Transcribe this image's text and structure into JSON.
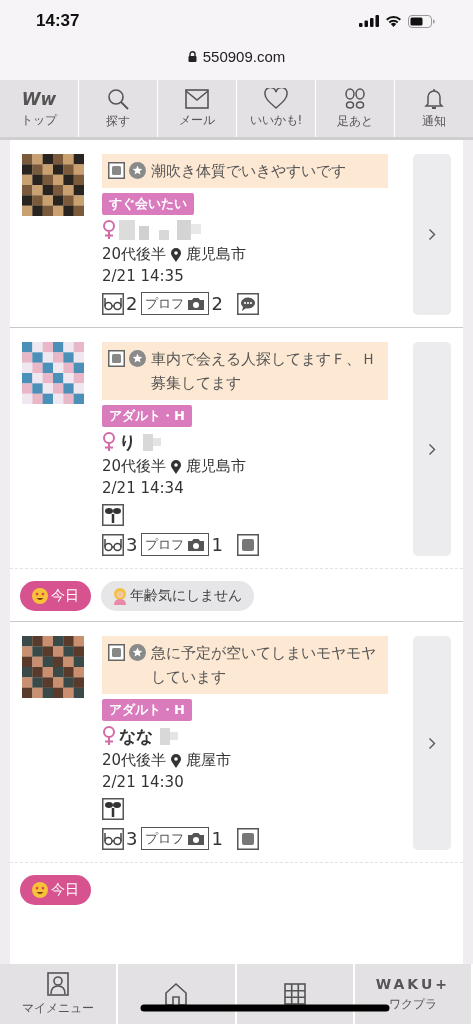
{
  "status_bar": {
    "time": "14:37"
  },
  "url_bar": {
    "url": "550909.com"
  },
  "top_nav": [
    {
      "kind": "logo",
      "logo": "Ww",
      "label": "トップ"
    },
    {
      "kind": "search",
      "label": "探す"
    },
    {
      "kind": "mail",
      "label": "メール"
    },
    {
      "kind": "heart",
      "label": "いいかも!"
    },
    {
      "kind": "footprints",
      "label": "足あと"
    },
    {
      "kind": "bell",
      "label": "通知"
    }
  ],
  "feed": [
    {
      "kind": "post",
      "message": "潮吹き体質でいきやすいです",
      "tag": "すぐ会いたい",
      "age": "20代後半",
      "city": "鹿児島市",
      "date": "2/21 14:35",
      "sprout": false,
      "views": "2",
      "profile_label": "プロフ",
      "photos": "2",
      "trailing": {
        "kind": "chat"
      }
    },
    {
      "kind": "post",
      "message": "車内で会える人探してますＦ、Ｈ募集してます",
      "tag": "アダルト・H",
      "name": "り",
      "age": "20代後半",
      "city": "鹿児島市",
      "date": "2/21 14:34",
      "sprout": true,
      "views": "3",
      "profile_label": "プロフ",
      "photos": "1",
      "trailing": {
        "kind": "badge"
      }
    },
    {
      "kind": "chips",
      "chips": [
        {
          "kind": "today",
          "label": "今日"
        },
        {
          "kind": "age",
          "label": "年齢気にしません"
        }
      ]
    },
    {
      "kind": "post",
      "message": "急に予定が空いてしまいモヤモヤしています",
      "tag": "アダルト・H",
      "name": "なな",
      "age": "20代後半",
      "city": "鹿屋市",
      "date": "2/21 14:30",
      "sprout": true,
      "views": "3",
      "profile_label": "プロフ",
      "photos": "1",
      "trailing": {
        "kind": "badge"
      }
    },
    {
      "kind": "chips",
      "chips": [
        {
          "kind": "today",
          "label": "今日"
        }
      ]
    }
  ],
  "bottom_nav": [
    {
      "kind": "person",
      "label": "マイメニュー"
    },
    {
      "kind": "home"
    },
    {
      "kind": "grid"
    },
    {
      "kind": "logo",
      "logo": "WAKU+",
      "label": "ワクプラ"
    }
  ]
}
